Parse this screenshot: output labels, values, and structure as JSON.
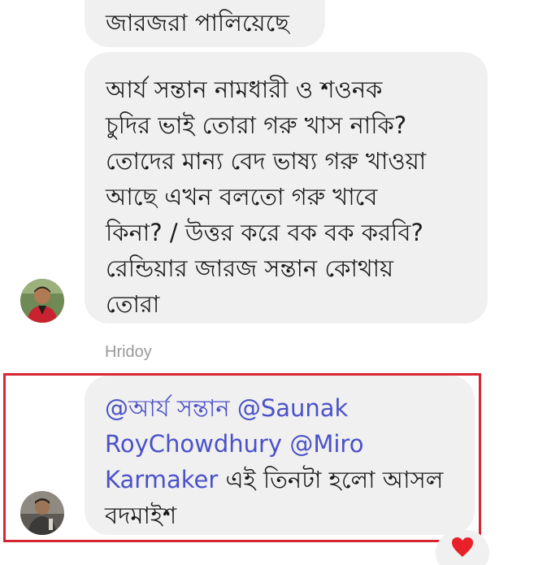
{
  "chat": {
    "messages": [
      {
        "lines": [
          "জারজরা পালিয়েছে"
        ]
      },
      {
        "lines": [
          "আর্য সন্তান নামধারী ও শওনক",
          "চুদির ভাই তোরা গরু খাস নাকি?",
          "তোদের মান্য বেদ ভাষ্য গরু খাওয়া",
          "আছে এখন বলতো গরু খাবে",
          "কিনা? / উত্তর করে বক বক করবি?",
          "রেন্ডিয়ার জারজ সন্তান কোথায়",
          "তোরা"
        ]
      }
    ],
    "reply": {
      "sender": "Hridoy",
      "mention_1": "@আর্য সন্তান",
      "mention_2a": "@Saunak",
      "mention_2b": "RoyChowdhury",
      "mention_3a": "@Miro",
      "mention_3b": "Karmaker",
      "text_part_1": "এই তিনটা হলো আসল",
      "text_part_2": "বদমাইশ",
      "reaction": "heart"
    }
  },
  "colors": {
    "bubble_background": "#f0f0f0",
    "mention_link": "#4b52c8",
    "highlight_border": "#d62631",
    "reaction_heart": "#e8202a"
  },
  "icons": {
    "avatar_1": "user-avatar",
    "avatar_2": "user-avatar",
    "reaction": "heart-icon"
  }
}
